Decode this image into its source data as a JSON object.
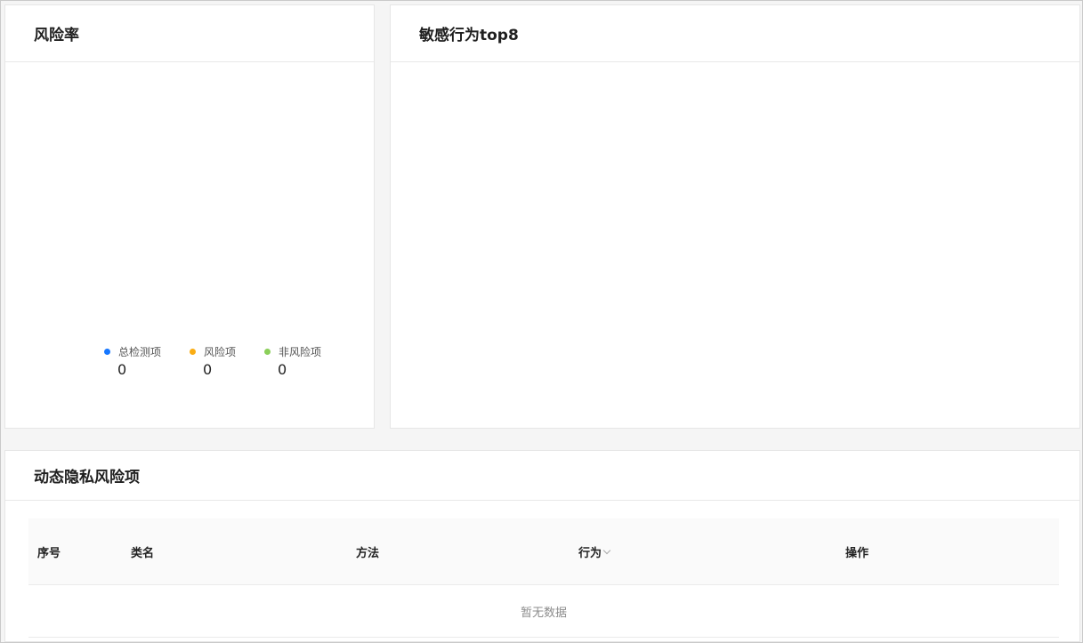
{
  "risk_card": {
    "title": "风险率",
    "legend": [
      {
        "label": "总检测项",
        "value": "0",
        "color": "#1677ff"
      },
      {
        "label": "风险项",
        "value": "0",
        "color": "#faad14"
      },
      {
        "label": "非风险项",
        "value": "0",
        "color": "#8bcf5a"
      }
    ]
  },
  "behavior_card": {
    "title": "敏感行为top8"
  },
  "dynamic_card": {
    "title": "动态隐私风险项",
    "table": {
      "columns": [
        "序号",
        "类名",
        "方法",
        "行为",
        "操作"
      ],
      "empty_text": "暂无数据"
    }
  }
}
